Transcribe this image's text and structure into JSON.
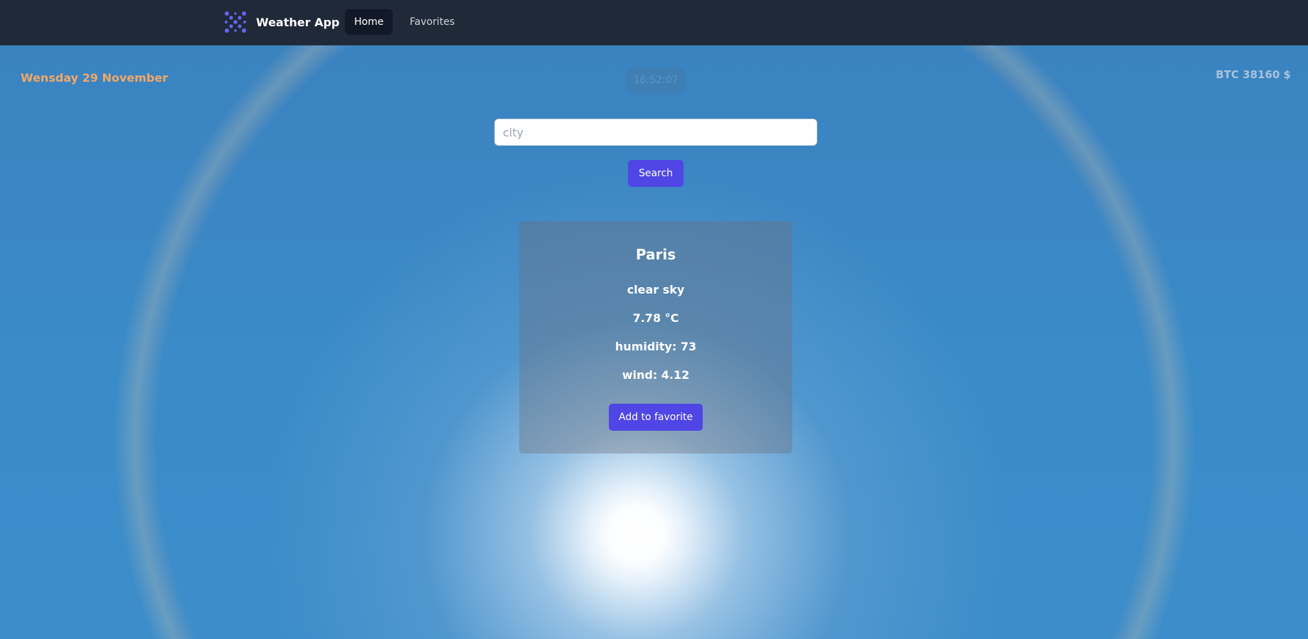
{
  "navbar": {
    "brand_name": "Weather App",
    "logo_icon": "dots-logo-icon",
    "links": [
      {
        "label": "Home",
        "active": true
      },
      {
        "label": "Favorites",
        "active": false
      }
    ]
  },
  "header": {
    "date": "Wensday 29 November",
    "time": "16:52:07",
    "btc": "BTC 38160 $"
  },
  "search": {
    "placeholder": "city",
    "value": "",
    "button_label": "Search"
  },
  "weather": {
    "city": "Paris",
    "description": "clear sky",
    "temperature": "7.78 °C",
    "humidity": "humidity: 73",
    "wind": "wind: 4.12",
    "favorite_label": "Add to favorite"
  },
  "colors": {
    "accent": "#4f46e5",
    "navbar": "#1f2937",
    "date_text": "#f0a868"
  }
}
